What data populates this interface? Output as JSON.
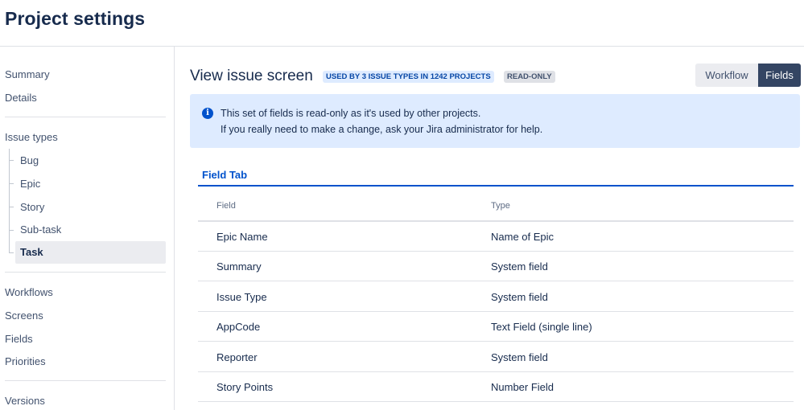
{
  "page": {
    "title": "Project settings"
  },
  "sidebar": {
    "top_items": [
      "Summary",
      "Details"
    ],
    "issue_types_label": "Issue types",
    "issue_types": [
      "Bug",
      "Epic",
      "Story",
      "Sub-task",
      "Task"
    ],
    "active_issue_type": "Task",
    "bottom_items": [
      "Workflows",
      "Screens",
      "Fields",
      "Priorities"
    ],
    "last_item": "Versions"
  },
  "main": {
    "title": "View issue screen",
    "usage_lozenge": "USED BY 3 ISSUE TYPES IN 1242 PROJECTS",
    "readonly_lozenge": "READ-ONLY",
    "view_toggle": {
      "workflow": "Workflow",
      "fields": "Fields",
      "selected": "Fields"
    },
    "banner": {
      "icon": "info-icon",
      "line1": "This set of fields is read-only as it's used by other projects.",
      "line2": "If you really need to make a change, ask your Jira administrator for help."
    },
    "tab_label": "Field Tab",
    "table": {
      "headers": [
        "Field",
        "Type"
      ],
      "rows": [
        {
          "field": "Epic Name",
          "type": "Name of Epic"
        },
        {
          "field": "Summary",
          "type": "System field"
        },
        {
          "field": "Issue Type",
          "type": "System field"
        },
        {
          "field": "AppCode",
          "type": "Text Field (single line)"
        },
        {
          "field": "Reporter",
          "type": "System field"
        },
        {
          "field": "Story Points",
          "type": "Number Field"
        }
      ]
    }
  },
  "colors": {
    "accent": "#0052cc",
    "selected_toggle": "#344563",
    "banner_bg": "#deebff"
  }
}
